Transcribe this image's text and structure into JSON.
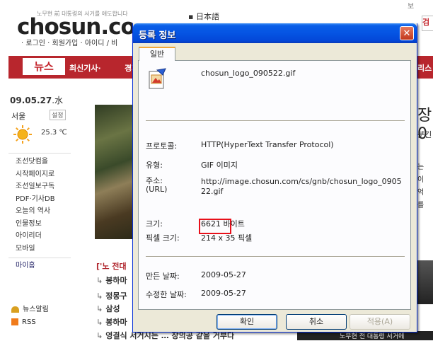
{
  "website": {
    "tagline": "노무현 前 대통령의 서거를 애도합니다",
    "logo_text": "chosun.co",
    "links": "· 로그인 · 회원가입 · 아이디 / 비",
    "lang": "▪ 日本語",
    "nav": {
      "news": "뉴스",
      "latest": "최신기사·",
      "economy": "경제",
      "right": "리스"
    },
    "date": "09.05.27",
    "dow": ".水",
    "city": "서울",
    "settings": "설정",
    "temp": "25.3 ℃",
    "side_items": [
      "조선닷컴을",
      "시작페이지로",
      "조선일보구독",
      "PDF·기사DB",
      "오늘의 역사",
      "인물정보",
      "아이리더",
      "모바일"
    ],
    "my_home": "마이홈",
    "news_alert": "뉴스알림",
    "rss": "RSS",
    "headline": "['노 전대",
    "list_items": [
      "봉하마",
      "정몽구",
      "삼성",
      "봉하마",
      "영결식 서거시는 … 장의공 같을 거부다"
    ],
    "search_btn": "검",
    "right_big": "장0",
    "right_small": "분긴",
    "right_lines": [
      "는",
      "이",
      "",
      "억",
      "를"
    ],
    "bottom_strip": "노무현 전 대통령 서거에",
    "top_right": "보"
  },
  "dialog": {
    "title": "등록 정보",
    "close_icon": "close-icon",
    "tab": "일반",
    "file_icon": "image-file-icon",
    "file_name": "chosun_logo_090522.gif",
    "protocol_label": "프로토콜:",
    "protocol_value": "HTTP(HyperText Transfer Protocol)",
    "type_label": "유형:",
    "type_value": "GIF 이미지",
    "address_label": "주소:\n(URL)",
    "address_value": "http://image.chosun.com/cs/gnb/chosun_logo_090522.gif",
    "size_label": "크기:",
    "size_value": "6621 바이트",
    "pixel_label": "픽셀 크기:",
    "pixel_value": "214  x  35  픽셀",
    "created_label": "만든 날짜:",
    "created_value": "2009-05-27",
    "modified_label": "수정한 날짜:",
    "modified_value": "2009-05-27",
    "ok": "확인",
    "cancel": "취소",
    "apply": "적용(A)"
  }
}
